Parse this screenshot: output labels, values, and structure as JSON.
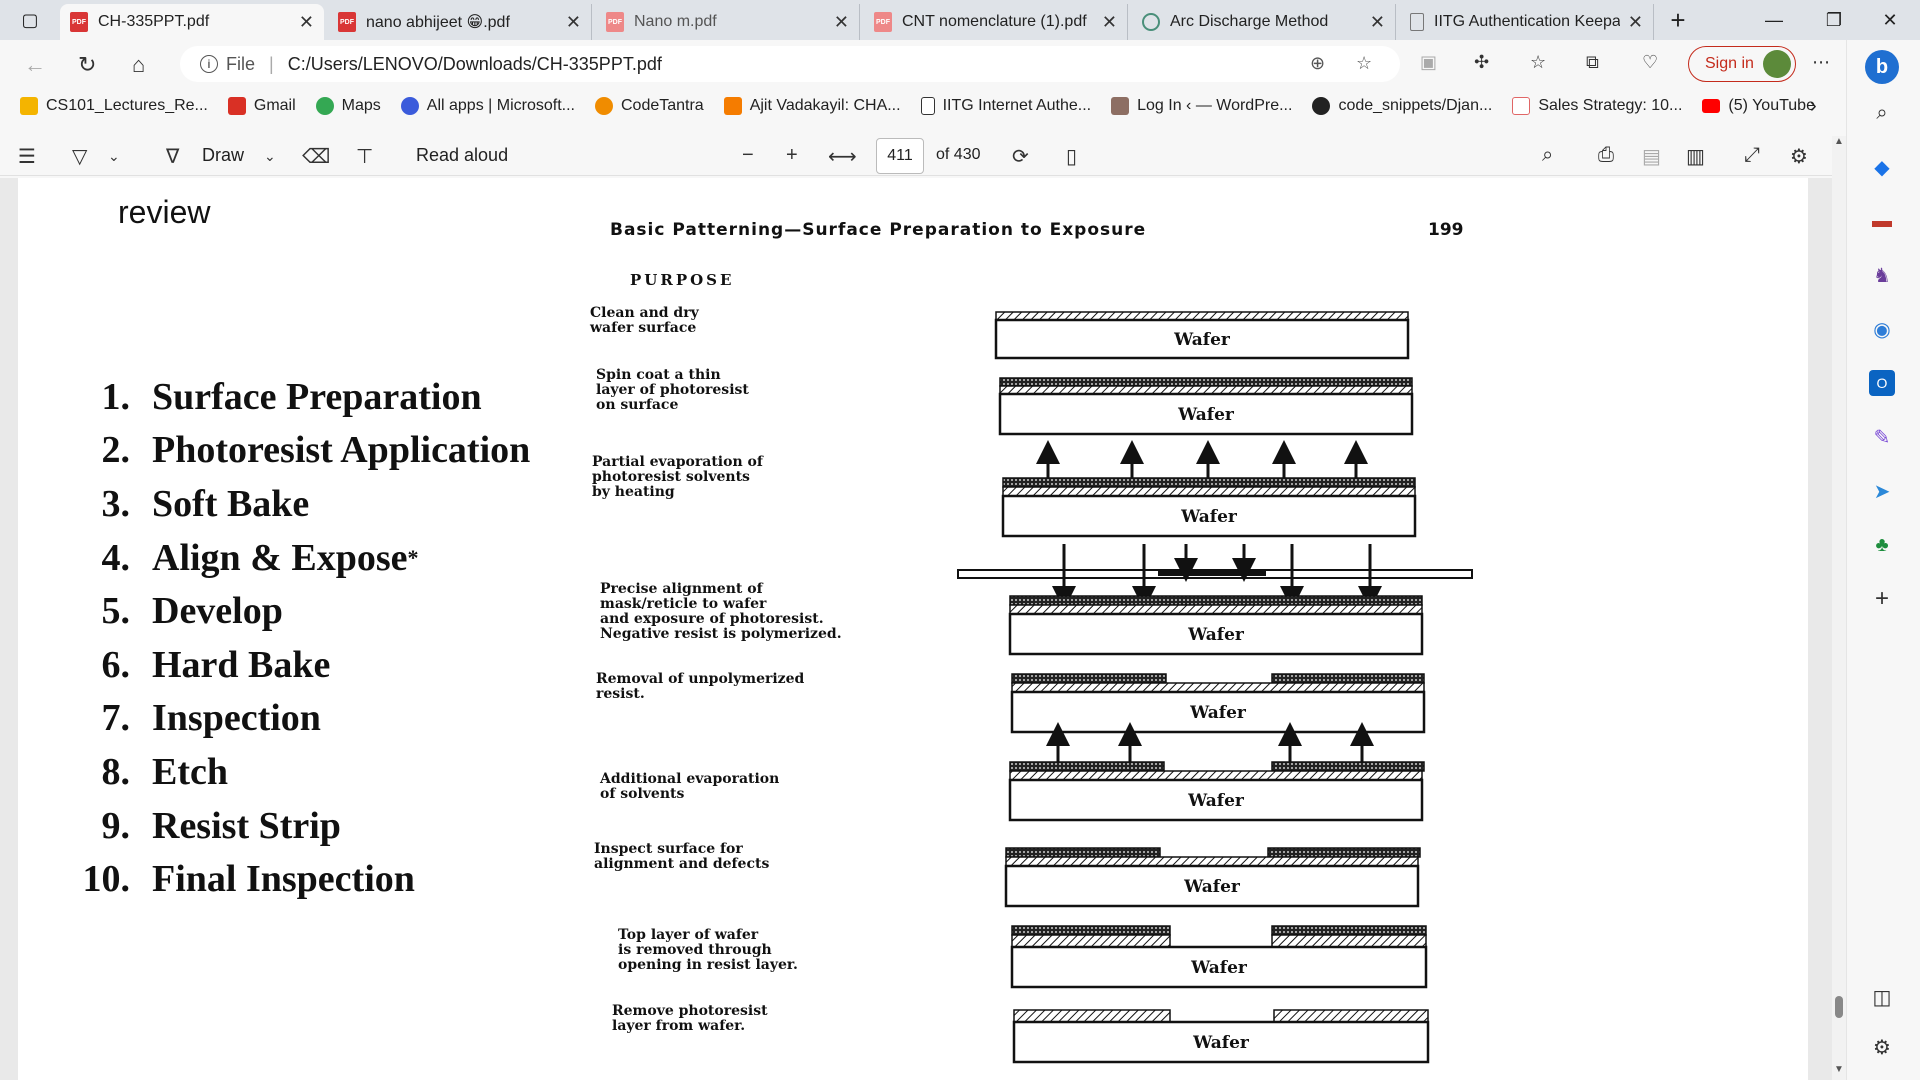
{
  "tabs": [
    {
      "title": "CH-335PPT.pdf",
      "active": true
    },
    {
      "title": "nano abhijeet 😁.pdf",
      "active": false
    },
    {
      "title": "Nano m.pdf",
      "active": false
    },
    {
      "title": "CNT nomenclature (1).pdf",
      "active": false
    },
    {
      "title": "Arc Discharge Method",
      "active": false
    },
    {
      "title": "IITG Authentication Keepali",
      "active": false
    }
  ],
  "address": {
    "file_label": "File",
    "url": "C:/Users/LENOVO/Downloads/CH-335PPT.pdf",
    "signin_label": "Sign in"
  },
  "bookmarks": [
    {
      "label": "CS101_Lectures_Re...",
      "color": "#f4b400"
    },
    {
      "label": "Gmail",
      "color": "#d93025"
    },
    {
      "label": "Maps",
      "color": "#34a853"
    },
    {
      "label": "All apps | Microsoft...",
      "color": "#3b5bdb"
    },
    {
      "label": "CodeTantra",
      "color": "#f08c00"
    },
    {
      "label": "Ajit Vadakayil: CHA...",
      "color": "#f57c00"
    },
    {
      "label": "IITG Internet Authe...",
      "color": "#cccccc"
    },
    {
      "label": "Log In ‹ — WordPre...",
      "color": "#8d6e63"
    },
    {
      "label": "code_snippets/Djan...",
      "color": "#222222"
    },
    {
      "label": "Sales Strategy: 10...",
      "color": "#e06666"
    },
    {
      "label": "(5) YouTube",
      "color": "#ff0000"
    }
  ],
  "pdf_toolbar": {
    "draw_label": "Draw",
    "read_aloud_label": "Read aloud",
    "page_current": "411",
    "page_total": "of 430"
  },
  "slide": {
    "review": "review",
    "steps": [
      {
        "n": "1.",
        "label": "Surface Preparation",
        "sup": ""
      },
      {
        "n": "2.",
        "label": "Photoresist Application",
        "sup": ""
      },
      {
        "n": "3.",
        "label": "Soft Bake",
        "sup": ""
      },
      {
        "n": "4.",
        "label": "Align & Expose",
        "sup": "*"
      },
      {
        "n": "5.",
        "label": "Develop",
        "sup": ""
      },
      {
        "n": "6.",
        "label": "Hard Bake",
        "sup": ""
      },
      {
        "n": "7.",
        "label": "Inspection",
        "sup": ""
      },
      {
        "n": "8.",
        "label": "Etch",
        "sup": ""
      },
      {
        "n": "9.",
        "label": "Resist Strip",
        "sup": ""
      },
      {
        "n": "10.",
        "label": "Final Inspection",
        "sup": ""
      }
    ],
    "figure_heading": "Basic Patterning—Surface Preparation to Exposure",
    "figure_page": "199",
    "purpose_heading": "PURPOSE",
    "wafer_label": "Wafer",
    "purposes": [
      "Clean and dry\nwafer surface",
      "Spin coat a thin\nlayer of photoresist\non surface",
      "Partial evaporation of\nphotoresist solvents\nby heating",
      "Precise alignment of\nmask/reticle to wafer\nand exposure of photoresist.\nNegative resist is polymerized.",
      "Removal of unpolymerized\nresist.",
      "Additional evaporation\nof solvents",
      "Inspect surface for\nalignment and defects",
      "Top layer of wafer\nis removed through\nopening in resist layer.",
      "Remove photoresist\nlayer from wafer."
    ]
  }
}
